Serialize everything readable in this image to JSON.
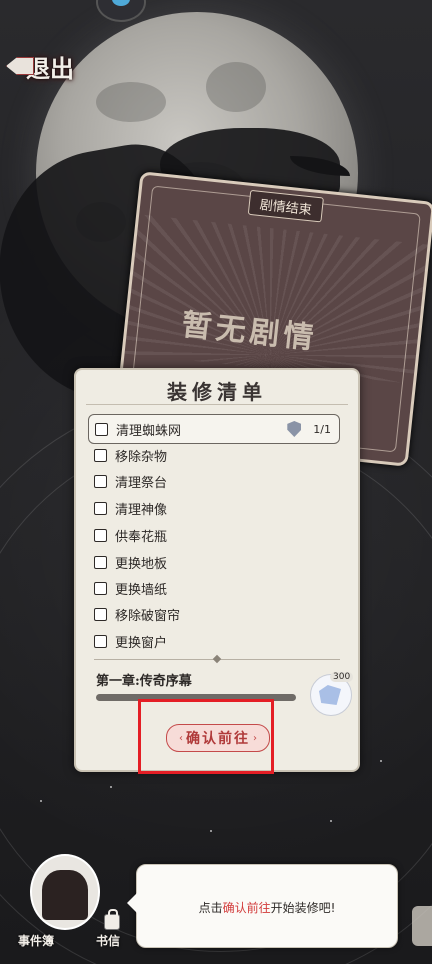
{
  "top_bar": {
    "exit_label": "退出"
  },
  "story_card": {
    "title": "剧情结束",
    "big_title": "暂无剧情"
  },
  "panel": {
    "title": "装修清单",
    "tasks": [
      {
        "label": "清理蜘蛛网",
        "checked": false,
        "progress": "1/1",
        "active": true
      },
      {
        "label": "移除杂物",
        "checked": false
      },
      {
        "label": "清理祭台",
        "checked": false
      },
      {
        "label": "清理神像",
        "checked": false
      },
      {
        "label": "供奉花瓶",
        "checked": false
      },
      {
        "label": "更换地板",
        "checked": false
      },
      {
        "label": "更换墙纸",
        "checked": false
      },
      {
        "label": "移除破窗帘",
        "checked": false
      },
      {
        "label": "更换窗户",
        "checked": false
      }
    ],
    "chapter_label": "第一章:传奇序幕",
    "chapter_progress": 0,
    "reward_amount": "300",
    "confirm_label": "确认前往"
  },
  "bottom": {
    "label_1": "事件簿",
    "label_2": "书信",
    "hint": {
      "prefix": "点击",
      "accent": "确认前往",
      "suffix": "开始装修吧!"
    }
  },
  "colors": {
    "accent_red": "#c44a4a",
    "highlight": "#e41e25",
    "panel_bg": "#efece3"
  }
}
